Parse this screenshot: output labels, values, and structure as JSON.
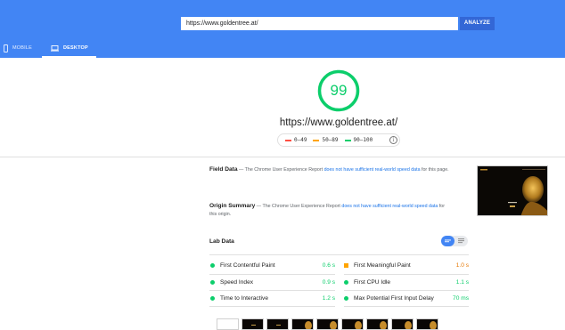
{
  "header": {
    "url_value": "https://www.goldentree.at/",
    "analyze_label": "ANALYZE",
    "tabs": [
      {
        "label": "MOBILE",
        "icon": "phone-icon",
        "selected": false
      },
      {
        "label": "DESKTOP",
        "icon": "desktop-icon",
        "selected": true
      }
    ]
  },
  "score": {
    "value": "99",
    "fraction": 0.99,
    "color": "#0cce6b",
    "url": "https://www.goldentree.at/",
    "legend": [
      {
        "range": "0–49",
        "color": "#ff4e42"
      },
      {
        "range": "50–89",
        "color": "#ffa400"
      },
      {
        "range": "90–100",
        "color": "#0cce6b"
      }
    ],
    "info_icon": "info-icon"
  },
  "field_data": {
    "label": "Field Data",
    "text": " — The Chrome User Experience Report ",
    "link": "does not have sufficient real-world speed data",
    "suffix": " for this page."
  },
  "origin_summary": {
    "label": "Origin Summary",
    "text": " — The Chrome User Experience Report ",
    "link": "does not have sufficient real-world speed data",
    "suffix": " for this origin."
  },
  "lab": {
    "title": "Lab Data",
    "metrics": [
      {
        "name": "First Contentful Paint",
        "value": "0.6 s",
        "status": "pass",
        "color": "#0cce6b"
      },
      {
        "name": "First Meaningful Paint",
        "value": "1.0 s",
        "status": "average",
        "color": "#ffa400"
      },
      {
        "name": "Speed Index",
        "value": "0.9 s",
        "status": "pass",
        "color": "#0cce6b"
      },
      {
        "name": "First CPU Idle",
        "value": "1.1 s",
        "status": "pass",
        "color": "#0cce6b"
      },
      {
        "name": "Time to Interactive",
        "value": "1.2 s",
        "status": "pass",
        "color": "#0cce6b"
      },
      {
        "name": "Max Potential First Input Delay",
        "value": "70 ms",
        "status": "pass",
        "color": "#0cce6b"
      }
    ]
  },
  "colors": {
    "header": "#4285f4",
    "button": "#3367d6",
    "pass": "#0cce6b",
    "average": "#ffa400",
    "fail": "#ff4e42",
    "link": "#1a73e8"
  }
}
